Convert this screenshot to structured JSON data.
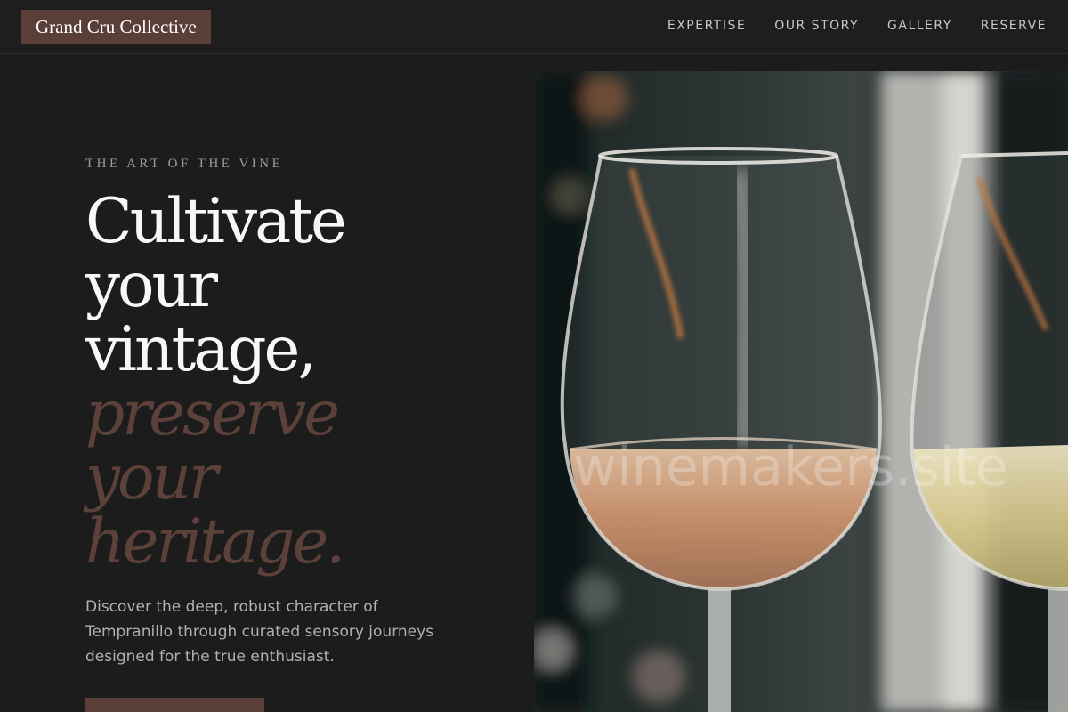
{
  "brand": {
    "name": "Grand Cru Collective"
  },
  "nav": {
    "items": [
      {
        "label": "EXPERTISE"
      },
      {
        "label": "OUR STORY"
      },
      {
        "label": "GALLERY"
      },
      {
        "label": "RESERVE"
      }
    ]
  },
  "hero": {
    "eyebrow": "THE ART OF THE VINE",
    "headline": {
      "line1": "Cultivate",
      "line2": "your",
      "line3": "vintage,",
      "line4": "preserve",
      "line5": "your",
      "line6": "heritage."
    },
    "lede": "Discover the deep, robust character of Tempranillo through curated sensory journeys designed for the true enthusiast.",
    "image": {
      "subject": "two-wine-glasses-rose-and-white",
      "watermark": "winemakers.site"
    }
  },
  "colors": {
    "background": "#1c1c1c",
    "accent": "#5a3f38",
    "headline_accent": "#5c413a",
    "headline": "#f7f7f7",
    "body_text": "#b5b0ad",
    "nav_text": "#c8c8c8"
  }
}
